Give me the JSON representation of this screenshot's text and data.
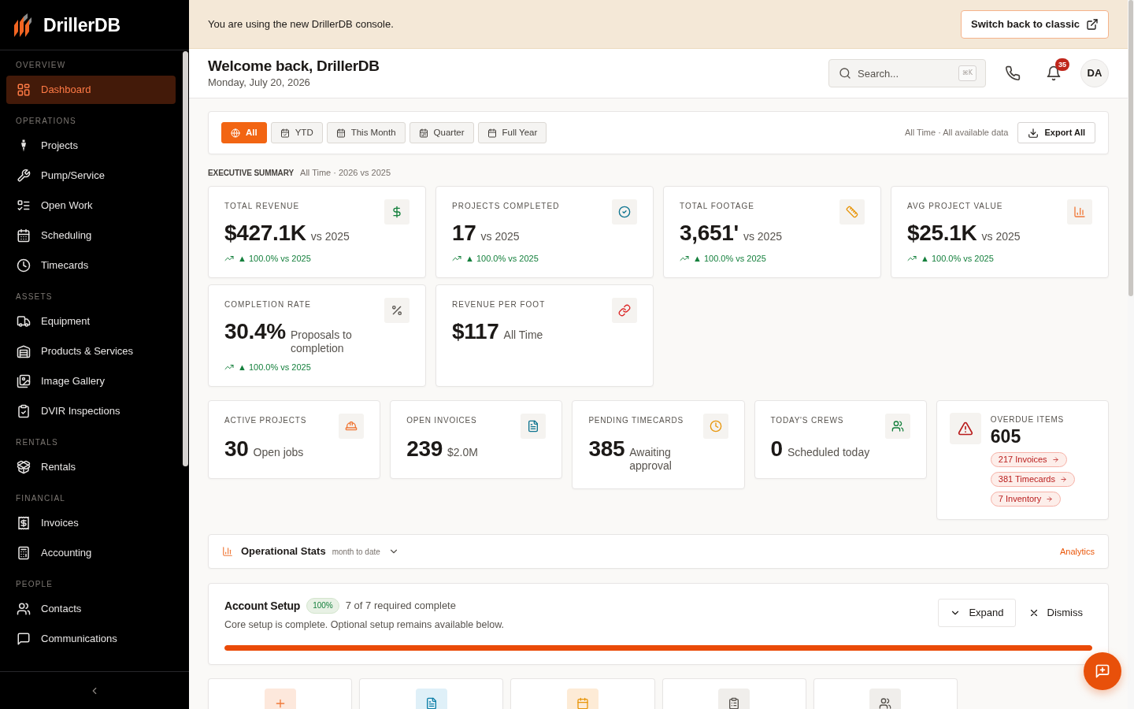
{
  "sidebar": {
    "brand": "DrillerDB",
    "sections": [
      {
        "heading": "OVERVIEW",
        "items": [
          {
            "label": "Dashboard",
            "kind": "dashboard",
            "selected": true
          }
        ]
      },
      {
        "heading": "OPERATIONS",
        "items": [
          {
            "label": "Projects",
            "kind": "projects",
            "selected": false
          },
          {
            "label": "Pump/Service",
            "kind": "service",
            "selected": false
          },
          {
            "label": "Open Work",
            "kind": "open_work",
            "selected": false
          },
          {
            "label": "Scheduling",
            "kind": "scheduling",
            "selected": false
          },
          {
            "label": "Timecards",
            "kind": "timecards",
            "selected": false
          }
        ]
      },
      {
        "heading": "ASSETS",
        "items": [
          {
            "label": "Equipment",
            "kind": "equipment",
            "selected": false
          },
          {
            "label": "Products & Services",
            "kind": "products",
            "selected": false
          },
          {
            "label": "Image Gallery",
            "kind": "gallery",
            "selected": false
          },
          {
            "label": "DVIR Inspections",
            "kind": "inspections",
            "selected": false
          }
        ]
      },
      {
        "heading": "RENTALS",
        "items": [
          {
            "label": "Rentals",
            "kind": "rentals",
            "selected": false
          }
        ]
      },
      {
        "heading": "FINANCIAL",
        "items": [
          {
            "label": "Invoices",
            "kind": "invoices",
            "selected": false
          },
          {
            "label": "Accounting",
            "kind": "accounting",
            "selected": false
          }
        ]
      },
      {
        "heading": "PEOPLE",
        "items": [
          {
            "label": "Contacts",
            "kind": "contacts",
            "selected": false
          },
          {
            "label": "Communications",
            "kind": "communications",
            "selected": false
          }
        ]
      }
    ]
  },
  "banner": {
    "message": "You are using the new DrillerDB console.",
    "button": "Switch back to classic"
  },
  "header": {
    "title": "Welcome back, DrillerDB",
    "date": "Monday, July 20, 2026",
    "search": {
      "placeholder": "Search...",
      "shortcut": "⌘K"
    },
    "notification_count": "35",
    "avatar": "DA"
  },
  "filters": {
    "options": [
      {
        "label": "All",
        "kind": "all",
        "selected": true
      },
      {
        "label": "YTD",
        "kind": "ytd",
        "selected": false
      },
      {
        "label": "This Month",
        "kind": "month",
        "selected": false
      },
      {
        "label": "Quarter",
        "kind": "quarter",
        "selected": false
      },
      {
        "label": "Full Year",
        "kind": "year",
        "selected": false
      }
    ],
    "summary": "All Time · All available data",
    "export_button": "Export All"
  },
  "executive_summary": {
    "heading": "EXECUTIVE SUMMARY",
    "subheading": "All Time · 2026 vs 2025",
    "cards": [
      {
        "kind": "revenue",
        "label": "TOTAL REVENUE",
        "value": "$427.1K",
        "note": "vs 2025",
        "trend": "▲ 100.0% vs 2025"
      },
      {
        "kind": "completed",
        "label": "PROJECTS COMPLETED",
        "value": "17",
        "note": "vs 2025",
        "trend": "▲ 100.0% vs 2025"
      },
      {
        "kind": "footage",
        "label": "TOTAL FOOTAGE",
        "value": "3,651'",
        "note": "vs 2025",
        "trend": "▲ 100.0% vs 2025"
      },
      {
        "kind": "avg_value",
        "label": "AVG PROJECT VALUE",
        "value": "$25.1K",
        "note": "vs 2025",
        "trend": "▲ 100.0% vs 2025"
      },
      {
        "kind": "completion_rate",
        "label": "COMPLETION RATE",
        "value": "30.4%",
        "note": "Proposals to completion",
        "trend": "▲ 100.0% vs 2025"
      },
      {
        "kind": "revenue_per_foot",
        "label": "REVENUE PER FOOT",
        "value": "$117",
        "note": "All Time"
      }
    ]
  },
  "operations": {
    "cards": [
      {
        "kind": "active_projects",
        "label": "ACTIVE PROJECTS",
        "value": "30",
        "note": "Open jobs"
      },
      {
        "kind": "open_invoices",
        "label": "OPEN INVOICES",
        "value": "239",
        "note": "$2.0M"
      },
      {
        "kind": "pending_timecards",
        "label": "PENDING TIMECARDS",
        "value": "385",
        "note": "Awaiting approval"
      },
      {
        "kind": "crews",
        "label": "TODAY'S CREWS",
        "value": "0",
        "note": "Scheduled today"
      },
      {
        "kind": "overdue",
        "label": "OVERDUE ITEMS",
        "value": "605",
        "links": [
          "217 Invoices",
          "381 Timecards",
          "7 Inventory"
        ]
      }
    ]
  },
  "operational_stats": {
    "title": "Operational Stats",
    "period": "month to date",
    "expanded": false,
    "link": "Analytics"
  },
  "account_setup": {
    "title": "Account Setup",
    "badge": "100%",
    "status": "7 of 7 required complete",
    "description": "Core setup is complete. Optional setup remains available below.",
    "level": 1,
    "expand_button": "Expand",
    "dismiss_button": "Dismiss"
  },
  "quick_actions": [
    {
      "kind": "add"
    },
    {
      "kind": "document"
    },
    {
      "kind": "calendar"
    },
    {
      "kind": "clipboard"
    },
    {
      "kind": "people"
    }
  ]
}
